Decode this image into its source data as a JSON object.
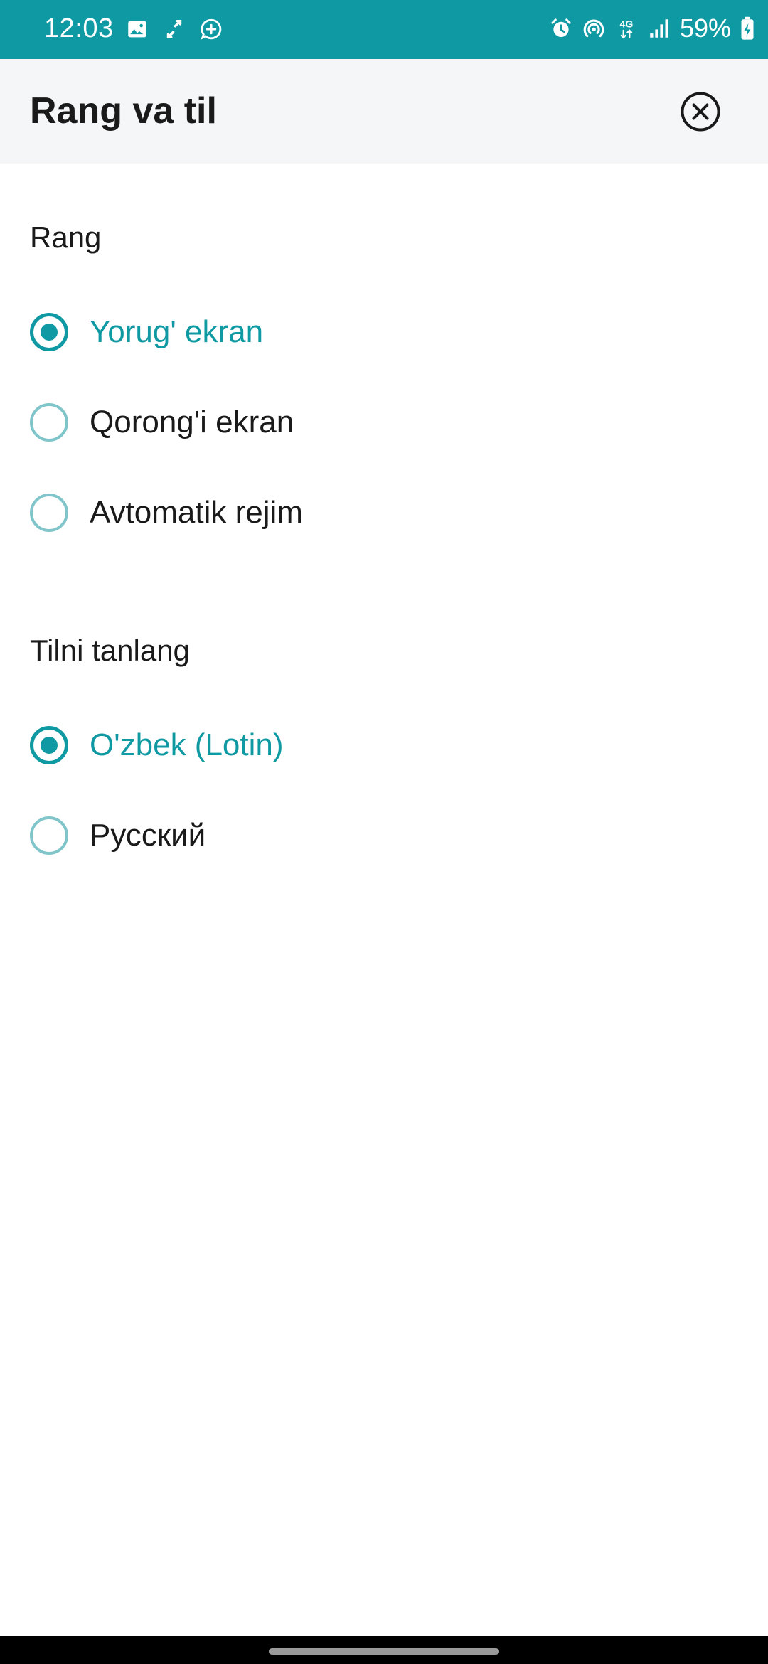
{
  "status_bar": {
    "time": "12:03",
    "battery_percent": "59%",
    "network_label": "4G",
    "left_icons": [
      "image-icon",
      "sync-icon",
      "chat-add-icon"
    ],
    "right_icons": [
      "alarm-icon",
      "hotspot-icon",
      "network-4g-icon",
      "signal-icon",
      "battery-charging-icon"
    ],
    "background_color": "#0f9aa3"
  },
  "header": {
    "title": "Rang va til",
    "close_icon": "close-circle-icon"
  },
  "theme_section": {
    "title": "Rang",
    "options": [
      {
        "label": "Yorug' ekran",
        "selected": true
      },
      {
        "label": "Qorong'i ekran",
        "selected": false
      },
      {
        "label": "Avtomatik rejim",
        "selected": false
      }
    ]
  },
  "language_section": {
    "title": "Tilni tanlang",
    "options": [
      {
        "label": "O'zbek (Lotin)",
        "selected": true
      },
      {
        "label": "Русский",
        "selected": false
      }
    ]
  },
  "colors": {
    "accent": "#0f9aa3",
    "radio_unselected_border": "#7fc5ca",
    "header_background": "#f5f6f7",
    "text": "#1a1a1a"
  }
}
